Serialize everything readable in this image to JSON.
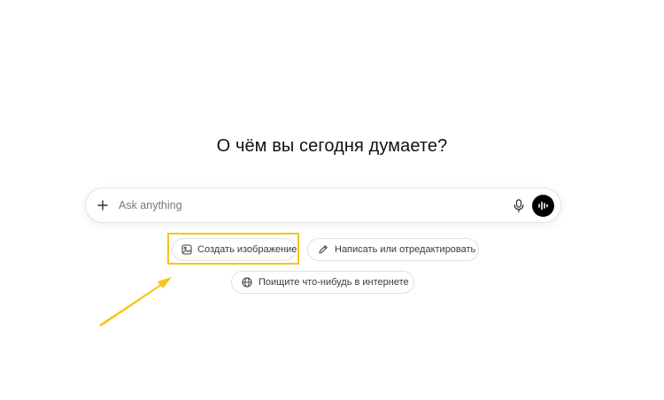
{
  "headline": "О чём вы сегодня думаете?",
  "composer": {
    "placeholder": "Ask anything",
    "add_icon": "plus-icon",
    "mic_icon": "microphone-icon",
    "voice_icon": "voice-waveform-icon"
  },
  "suggestions": [
    {
      "label": "Создать изображение",
      "icon": "image-icon"
    },
    {
      "label": "Написать или отредактировать",
      "icon": "pencil-icon"
    },
    {
      "label": "Поищите что-нибудь в интернете",
      "icon": "globe-icon"
    }
  ],
  "annotation": {
    "color": "#f5c518",
    "highlighted": "Создать изображение"
  }
}
